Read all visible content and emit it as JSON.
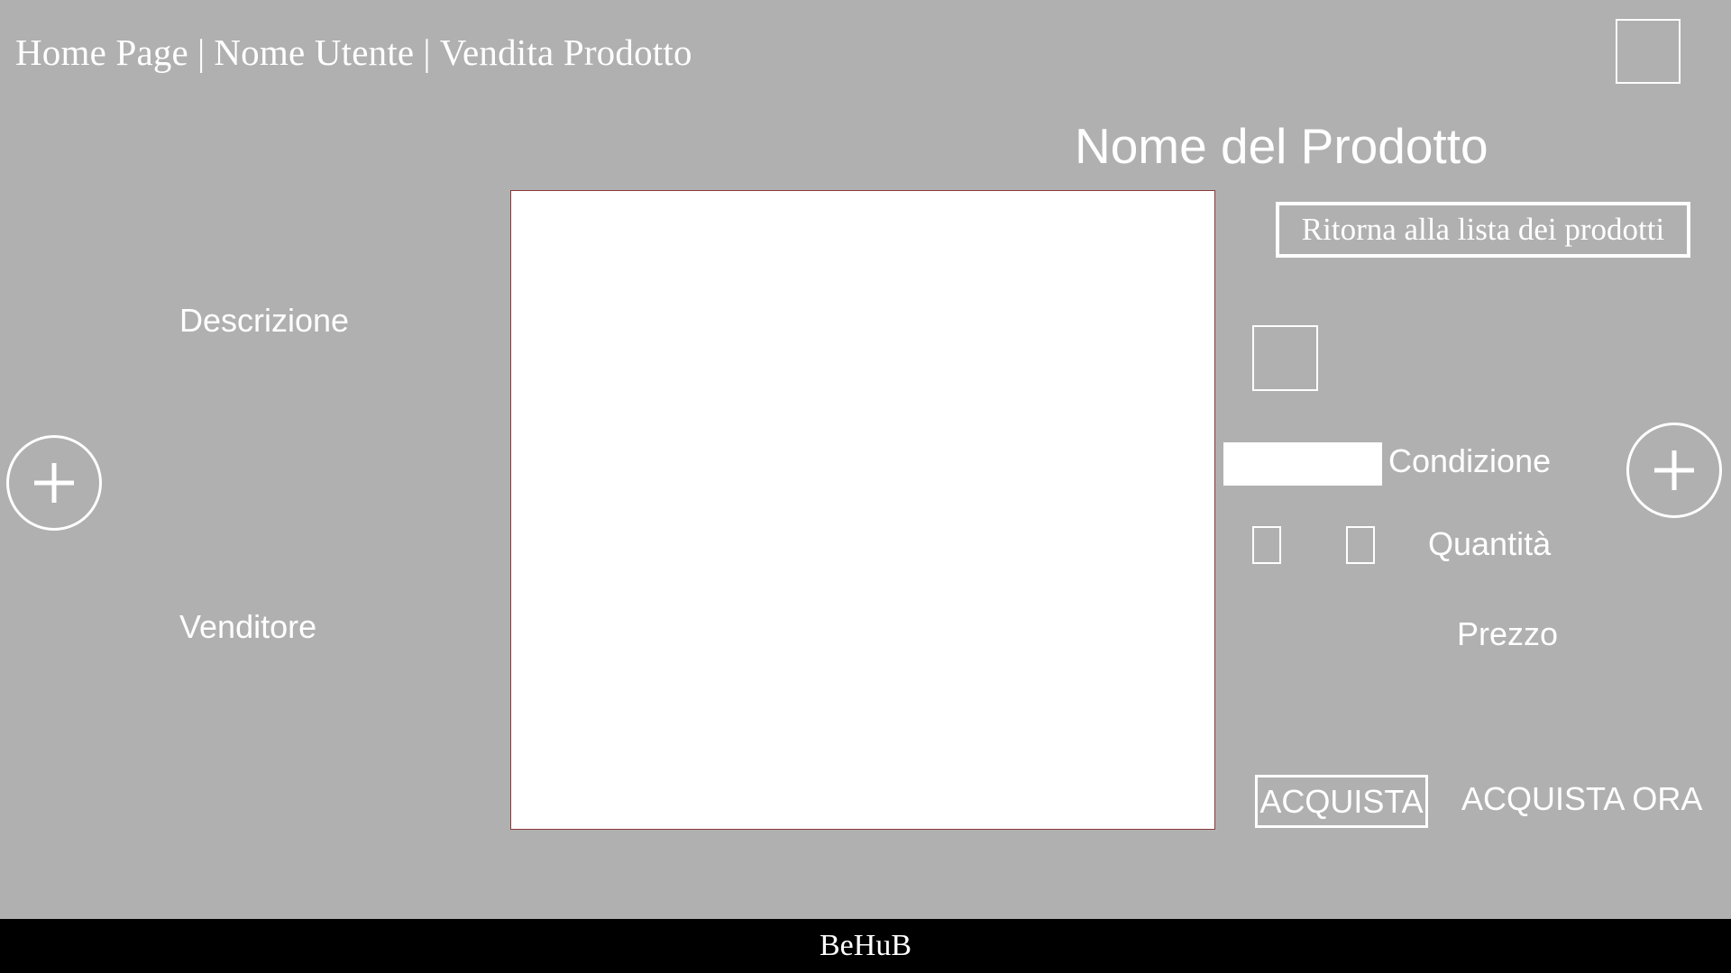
{
  "header": {
    "breadcrumb": {
      "home": "Home Page",
      "separator": "|",
      "user": "Nome Utente",
      "section": "Vendita Prodotto"
    },
    "profile_icon": "square-outline-icon"
  },
  "product": {
    "title": "Nome del Prodotto",
    "back_label": "Ritorna alla lista dei prodotti",
    "description_label": "Descrizione",
    "seller_label": "Venditore",
    "condition_label": "Condizione",
    "condition_value": "",
    "quantity_label": "Quantità",
    "price_label": "Prezzo"
  },
  "actions": {
    "buy_label": "ACQUISTA",
    "buy_now_label": "ACQUISTA ORA",
    "prev_icon": "plus-circle-icon",
    "next_icon": "plus-circle-icon"
  },
  "footer": {
    "brand": "BeHuB"
  },
  "colors": {
    "background": "#b0b0b0",
    "text": "#ffffff",
    "footer": "#000000",
    "image_border": "#8b3a3a"
  }
}
